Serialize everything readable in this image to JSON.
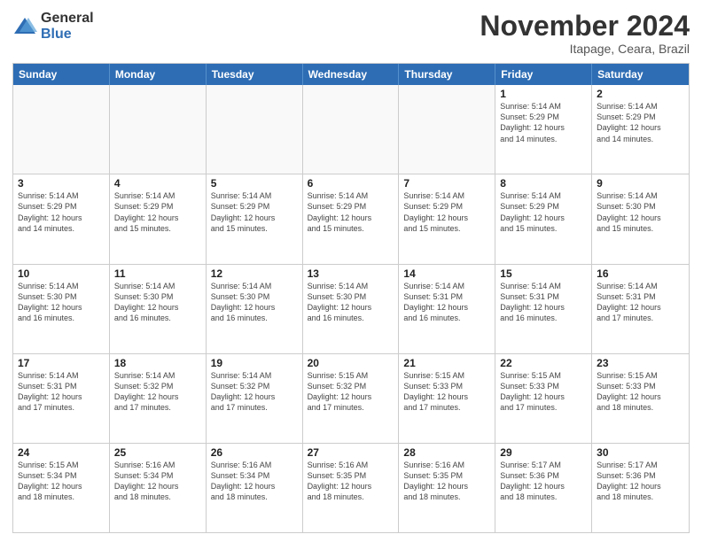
{
  "logo": {
    "general": "General",
    "blue": "Blue"
  },
  "header": {
    "title": "November 2024",
    "subtitle": "Itapage, Ceara, Brazil"
  },
  "weekdays": [
    "Sunday",
    "Monday",
    "Tuesday",
    "Wednesday",
    "Thursday",
    "Friday",
    "Saturday"
  ],
  "rows": [
    [
      {
        "day": "",
        "text": "",
        "empty": true
      },
      {
        "day": "",
        "text": "",
        "empty": true
      },
      {
        "day": "",
        "text": "",
        "empty": true
      },
      {
        "day": "",
        "text": "",
        "empty": true
      },
      {
        "day": "",
        "text": "",
        "empty": true
      },
      {
        "day": "1",
        "text": "Sunrise: 5:14 AM\nSunset: 5:29 PM\nDaylight: 12 hours\nand 14 minutes.",
        "empty": false
      },
      {
        "day": "2",
        "text": "Sunrise: 5:14 AM\nSunset: 5:29 PM\nDaylight: 12 hours\nand 14 minutes.",
        "empty": false
      }
    ],
    [
      {
        "day": "3",
        "text": "Sunrise: 5:14 AM\nSunset: 5:29 PM\nDaylight: 12 hours\nand 14 minutes.",
        "empty": false
      },
      {
        "day": "4",
        "text": "Sunrise: 5:14 AM\nSunset: 5:29 PM\nDaylight: 12 hours\nand 15 minutes.",
        "empty": false
      },
      {
        "day": "5",
        "text": "Sunrise: 5:14 AM\nSunset: 5:29 PM\nDaylight: 12 hours\nand 15 minutes.",
        "empty": false
      },
      {
        "day": "6",
        "text": "Sunrise: 5:14 AM\nSunset: 5:29 PM\nDaylight: 12 hours\nand 15 minutes.",
        "empty": false
      },
      {
        "day": "7",
        "text": "Sunrise: 5:14 AM\nSunset: 5:29 PM\nDaylight: 12 hours\nand 15 minutes.",
        "empty": false
      },
      {
        "day": "8",
        "text": "Sunrise: 5:14 AM\nSunset: 5:29 PM\nDaylight: 12 hours\nand 15 minutes.",
        "empty": false
      },
      {
        "day": "9",
        "text": "Sunrise: 5:14 AM\nSunset: 5:30 PM\nDaylight: 12 hours\nand 15 minutes.",
        "empty": false
      }
    ],
    [
      {
        "day": "10",
        "text": "Sunrise: 5:14 AM\nSunset: 5:30 PM\nDaylight: 12 hours\nand 16 minutes.",
        "empty": false
      },
      {
        "day": "11",
        "text": "Sunrise: 5:14 AM\nSunset: 5:30 PM\nDaylight: 12 hours\nand 16 minutes.",
        "empty": false
      },
      {
        "day": "12",
        "text": "Sunrise: 5:14 AM\nSunset: 5:30 PM\nDaylight: 12 hours\nand 16 minutes.",
        "empty": false
      },
      {
        "day": "13",
        "text": "Sunrise: 5:14 AM\nSunset: 5:30 PM\nDaylight: 12 hours\nand 16 minutes.",
        "empty": false
      },
      {
        "day": "14",
        "text": "Sunrise: 5:14 AM\nSunset: 5:31 PM\nDaylight: 12 hours\nand 16 minutes.",
        "empty": false
      },
      {
        "day": "15",
        "text": "Sunrise: 5:14 AM\nSunset: 5:31 PM\nDaylight: 12 hours\nand 16 minutes.",
        "empty": false
      },
      {
        "day": "16",
        "text": "Sunrise: 5:14 AM\nSunset: 5:31 PM\nDaylight: 12 hours\nand 17 minutes.",
        "empty": false
      }
    ],
    [
      {
        "day": "17",
        "text": "Sunrise: 5:14 AM\nSunset: 5:31 PM\nDaylight: 12 hours\nand 17 minutes.",
        "empty": false
      },
      {
        "day": "18",
        "text": "Sunrise: 5:14 AM\nSunset: 5:32 PM\nDaylight: 12 hours\nand 17 minutes.",
        "empty": false
      },
      {
        "day": "19",
        "text": "Sunrise: 5:14 AM\nSunset: 5:32 PM\nDaylight: 12 hours\nand 17 minutes.",
        "empty": false
      },
      {
        "day": "20",
        "text": "Sunrise: 5:15 AM\nSunset: 5:32 PM\nDaylight: 12 hours\nand 17 minutes.",
        "empty": false
      },
      {
        "day": "21",
        "text": "Sunrise: 5:15 AM\nSunset: 5:33 PM\nDaylight: 12 hours\nand 17 minutes.",
        "empty": false
      },
      {
        "day": "22",
        "text": "Sunrise: 5:15 AM\nSunset: 5:33 PM\nDaylight: 12 hours\nand 17 minutes.",
        "empty": false
      },
      {
        "day": "23",
        "text": "Sunrise: 5:15 AM\nSunset: 5:33 PM\nDaylight: 12 hours\nand 18 minutes.",
        "empty": false
      }
    ],
    [
      {
        "day": "24",
        "text": "Sunrise: 5:15 AM\nSunset: 5:34 PM\nDaylight: 12 hours\nand 18 minutes.",
        "empty": false
      },
      {
        "day": "25",
        "text": "Sunrise: 5:16 AM\nSunset: 5:34 PM\nDaylight: 12 hours\nand 18 minutes.",
        "empty": false
      },
      {
        "day": "26",
        "text": "Sunrise: 5:16 AM\nSunset: 5:34 PM\nDaylight: 12 hours\nand 18 minutes.",
        "empty": false
      },
      {
        "day": "27",
        "text": "Sunrise: 5:16 AM\nSunset: 5:35 PM\nDaylight: 12 hours\nand 18 minutes.",
        "empty": false
      },
      {
        "day": "28",
        "text": "Sunrise: 5:16 AM\nSunset: 5:35 PM\nDaylight: 12 hours\nand 18 minutes.",
        "empty": false
      },
      {
        "day": "29",
        "text": "Sunrise: 5:17 AM\nSunset: 5:36 PM\nDaylight: 12 hours\nand 18 minutes.",
        "empty": false
      },
      {
        "day": "30",
        "text": "Sunrise: 5:17 AM\nSunset: 5:36 PM\nDaylight: 12 hours\nand 18 minutes.",
        "empty": false
      }
    ]
  ]
}
